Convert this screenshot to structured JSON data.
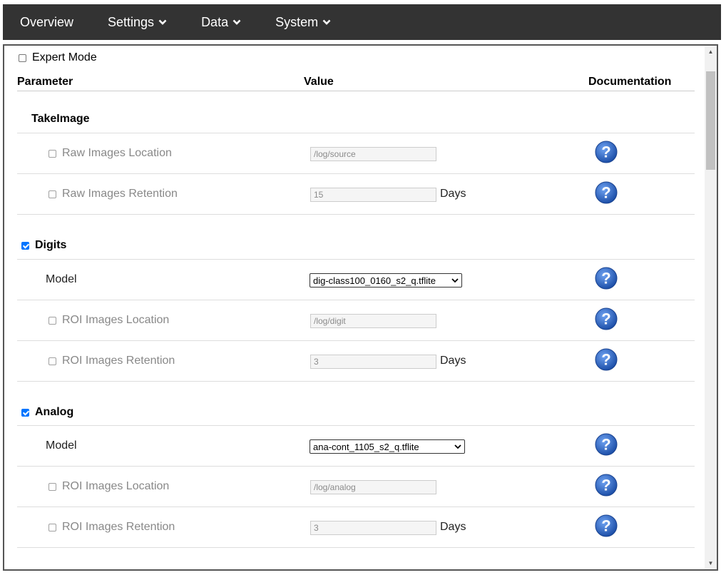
{
  "nav": {
    "items": [
      {
        "label": "Overview",
        "dropdown": false
      },
      {
        "label": "Settings",
        "dropdown": true
      },
      {
        "label": "Data",
        "dropdown": true
      },
      {
        "label": "System",
        "dropdown": true
      }
    ]
  },
  "expert_mode": {
    "label": "Expert Mode",
    "checked": false
  },
  "table": {
    "headers": {
      "parameter": "Parameter",
      "value": "Value",
      "documentation": "Documentation"
    }
  },
  "sections": {
    "takeimage": {
      "title": "TakeImage",
      "raw_location": {
        "label": "Raw Images Location",
        "value": "/log/source"
      },
      "raw_retention": {
        "label": "Raw Images Retention",
        "value": "15",
        "unit": "Days"
      }
    },
    "digits": {
      "title": "Digits",
      "checked": true,
      "model": {
        "label": "Model",
        "value": "dig-class100_0160_s2_q.tflite"
      },
      "roi_location": {
        "label": "ROI Images Location",
        "value": "/log/digit"
      },
      "roi_retention": {
        "label": "ROI Images Retention",
        "value": "3",
        "unit": "Days"
      }
    },
    "analog": {
      "title": "Analog",
      "checked": true,
      "model": {
        "label": "Model",
        "value": "ana-cont_1105_s2_q.tflite"
      },
      "roi_location": {
        "label": "ROI Images Location",
        "value": "/log/analog"
      },
      "roi_retention": {
        "label": "ROI Images Retention",
        "value": "3",
        "unit": "Days"
      }
    }
  },
  "colors": {
    "navbar": "#333333",
    "help_icon": "#2a5db0",
    "checkbox_checked": "#0075ff"
  },
  "icons": {
    "help": "question-help-icon",
    "chevron": "chevron-down-icon"
  }
}
